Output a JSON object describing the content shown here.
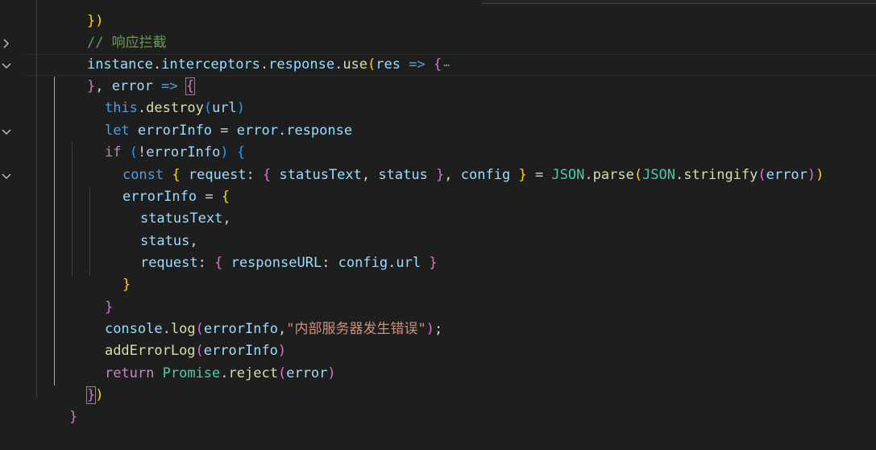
{
  "editor": {
    "colors": {
      "background": "#1e1e1e",
      "comment": "#6a9955",
      "keyword": "#569cd6",
      "control": "#c586c0",
      "variable": "#9cdcfe",
      "function": "#dcdcaa",
      "class": "#4ec9b0",
      "string": "#ce9178",
      "bracket1": "#ffd700",
      "bracket2": "#da70d6",
      "bracket3": "#179fff"
    },
    "fold_icons": [
      "chevron-right-icon",
      "chevron-down-icon"
    ],
    "folded_ellipsis": "⋯",
    "lines": {
      "l0": {
        "t0": "})"
      },
      "l1": {
        "t0": "// 响应拦截"
      },
      "l2": {
        "t0": "instance",
        "t1": ".",
        "t2": "interceptors",
        "t3": ".",
        "t4": "response",
        "t5": ".",
        "t6": "use",
        "t7": "(",
        "t8": "res",
        "t9": " => ",
        "t10": "{"
      },
      "l3": {
        "t0": "}",
        "t1": ", ",
        "t2": "error",
        "t3": " => ",
        "t4": "{"
      },
      "l4": {
        "t0": "this",
        "t1": ".",
        "t2": "destroy",
        "t3": "(",
        "t4": "url",
        "t5": ")"
      },
      "l5": {
        "t0": "let",
        "t1": " ",
        "t2": "errorInfo",
        "t3": " = ",
        "t4": "error",
        "t5": ".",
        "t6": "response"
      },
      "l6": {
        "t0": "if",
        "t1": " ",
        "t2": "(",
        "t3": "!",
        "t4": "errorInfo",
        "t5": ")",
        "t6": " ",
        "t7": "{"
      },
      "l7": {
        "t0": "const",
        "t1": " ",
        "t2": "{",
        "t3": " ",
        "t4": "request",
        "t5": ": ",
        "t6": "{",
        "t7": " ",
        "t8": "statusText",
        "t9": ", ",
        "t10": "status",
        "t11": " ",
        "t12": "}",
        "t13": ", ",
        "t14": "config",
        "t15": " ",
        "t16": "}",
        "t17": " = ",
        "t18": "JSON",
        "t19": ".",
        "t20": "parse",
        "t21": "(",
        "t22": "JSON",
        "t23": ".",
        "t24": "stringify",
        "t25": "(",
        "t26": "error",
        "t27": ")",
        "t28": ")"
      },
      "l8": {
        "t0": "errorInfo",
        "t1": " = ",
        "t2": "{"
      },
      "l9": {
        "t0": "statusText",
        "t1": ","
      },
      "l10": {
        "t0": "status",
        "t1": ","
      },
      "l11": {
        "t0": "request",
        "t1": ": ",
        "t2": "{",
        "t3": " ",
        "t4": "responseURL",
        "t5": ": ",
        "t6": "config",
        "t7": ".",
        "t8": "url",
        "t9": " ",
        "t10": "}"
      },
      "l12": {
        "t0": "}"
      },
      "l13": {
        "t0": "}"
      },
      "l14": {
        "t0": "console",
        "t1": ".",
        "t2": "log",
        "t3": "(",
        "t4": "errorInfo",
        "t5": ",",
        "t6": "\"内部服务器发生错误\"",
        "t7": ")",
        "t8": ";"
      },
      "l15": {
        "t0": "addErrorLog",
        "t1": "(",
        "t2": "errorInfo",
        "t3": ")"
      },
      "l16": {
        "t0": "return",
        "t1": " ",
        "t2": "Promise",
        "t3": ".",
        "t4": "reject",
        "t5": "(",
        "t6": "error",
        "t7": ")"
      },
      "l17": {
        "t0": "}",
        "t1": ")"
      },
      "l18": {
        "t0": "}"
      }
    }
  }
}
